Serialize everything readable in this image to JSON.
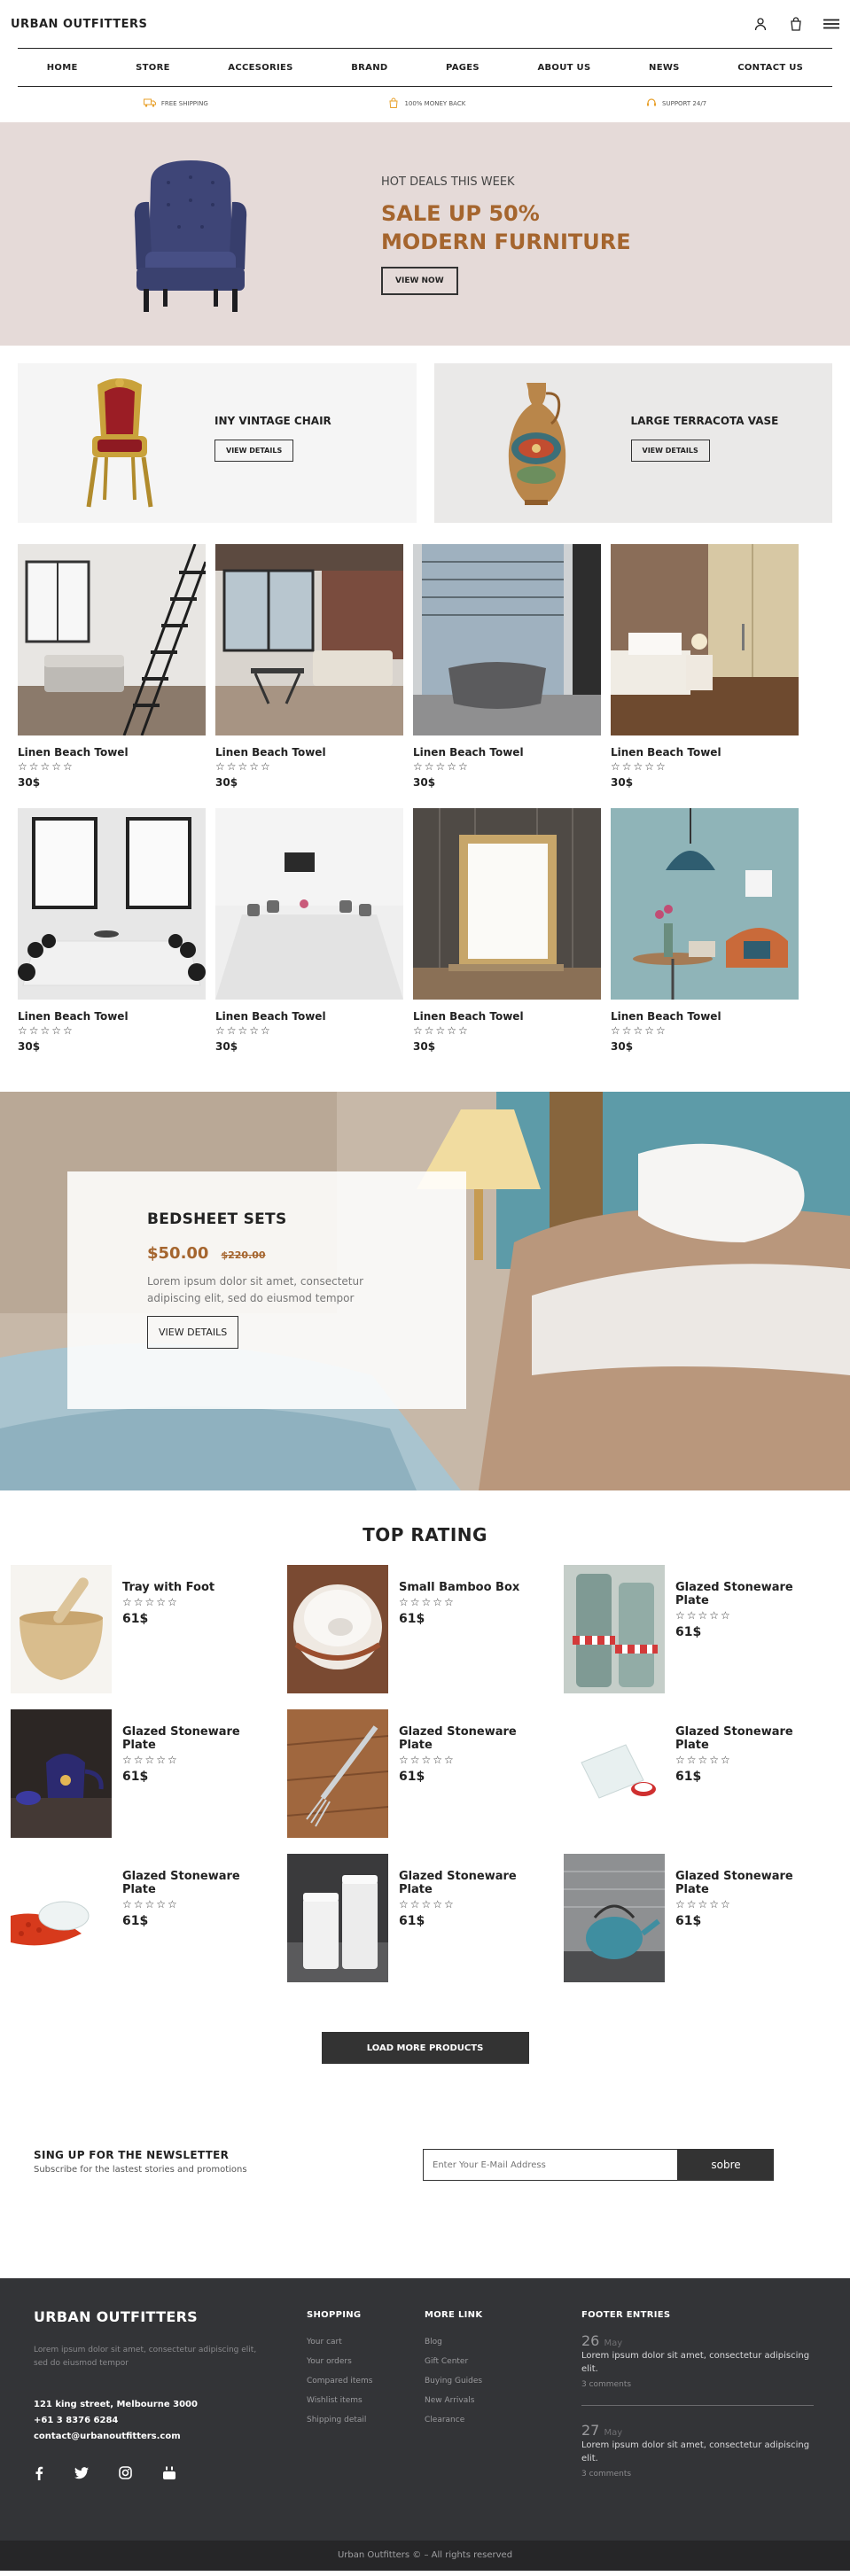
{
  "header": {
    "brand": "URBAN OUTFITTERS",
    "icons": [
      "user-icon",
      "bag-icon",
      "menu-icon"
    ]
  },
  "nav": [
    "HOME",
    "STORE",
    "ACCESORIES",
    "BRAND",
    "PAGES",
    "ABOUT US",
    "NEWS",
    "CONTACT US"
  ],
  "services": [
    {
      "icon": "truck-icon",
      "label": "FREE SHIPPING"
    },
    {
      "icon": "bag-money-icon",
      "label": "100% MONEY BACK"
    },
    {
      "icon": "support-icon",
      "label": "SUPPORT 24/7"
    }
  ],
  "hero": {
    "kicker": "HOT DEALS THIS WEEK",
    "title_line1": "SALE UP 50%",
    "title_line2": "MODERN FURNITURE",
    "button": "VIEW NOW"
  },
  "promos": [
    {
      "title": "INY VINTAGE CHAIR",
      "button": "VIEW DETAILS"
    },
    {
      "title": "LARGE TERRACOTA VASE",
      "button": "VIEW DETAILS"
    }
  ],
  "products": [
    {
      "name": "Linen Beach Towel",
      "stars": "☆☆☆☆☆",
      "price": "30$"
    },
    {
      "name": "Linen Beach Towel",
      "stars": "☆☆☆☆☆",
      "price": "30$"
    },
    {
      "name": "Linen Beach Towel",
      "stars": "☆☆☆☆☆",
      "price": "30$"
    },
    {
      "name": "Linen Beach Towel",
      "stars": "☆☆☆☆☆",
      "price": "30$"
    },
    {
      "name": "Linen Beach Towel",
      "stars": "☆☆☆☆☆",
      "price": "30$"
    },
    {
      "name": "Linen Beach Towel",
      "stars": "☆☆☆☆☆",
      "price": "30$"
    },
    {
      "name": "Linen Beach Towel",
      "stars": "☆☆☆☆☆",
      "price": "30$"
    },
    {
      "name": "Linen Beach Towel",
      "stars": "☆☆☆☆☆",
      "price": "30$"
    }
  ],
  "bedsheet": {
    "title": "BEDSHEET SETS",
    "price": "$50.00",
    "old_price": "$220.00",
    "description": "Lorem ipsum dolor sit amet, consectetur adipiscing elit, sed do eiusmod tempor",
    "button": "VIEW DETAILS"
  },
  "top_rating": {
    "title": "TOP RATING",
    "items": [
      {
        "name": "Tray with Foot",
        "stars": "☆☆☆☆☆",
        "price": "61$"
      },
      {
        "name": "Small Bamboo Box",
        "stars": "☆☆☆☆☆",
        "price": "61$"
      },
      {
        "name": "Glazed Stoneware Plate",
        "stars": "☆☆☆☆☆",
        "price": "61$"
      },
      {
        "name": "Glazed Stoneware Plate",
        "stars": "☆☆☆☆☆",
        "price": "61$"
      },
      {
        "name": "Glazed Stoneware Plate",
        "stars": "☆☆☆☆☆",
        "price": "61$"
      },
      {
        "name": "Glazed Stoneware Plate",
        "stars": "☆☆☆☆☆",
        "price": "61$"
      },
      {
        "name": "Glazed Stoneware Plate",
        "stars": "☆☆☆☆☆",
        "price": "61$"
      },
      {
        "name": "Glazed Stoneware Plate",
        "stars": "☆☆☆☆☆",
        "price": "61$"
      },
      {
        "name": "Glazed Stoneware Plate",
        "stars": "☆☆☆☆☆",
        "price": "61$"
      }
    ]
  },
  "load_more": "LOAD MORE PRODUCTS",
  "newsletter": {
    "title": "SING UP FOR THE NEWSLETTER",
    "subtitle": "Subscribe for the lastest stories and promotions",
    "placeholder": "Enter Your E-Mail Address",
    "button": "sobre"
  },
  "footer": {
    "brand": "URBAN OUTFITTERS",
    "description": "Lorem ipsum dolor sit amet, consectetur adipiscing elit, sed do eiusmod tempor",
    "address": "121 king street, Melbourne 3000",
    "phone": "+61 3 8376 6284",
    "email": "contact@urbanoutfitters.com",
    "social": [
      "facebook-icon",
      "twitter-icon",
      "instagram-icon",
      "youtube-icon"
    ],
    "shopping": {
      "title": "SHOPPING",
      "links": [
        "Your cart",
        "Your orders",
        "Compared items",
        "Wishlist items",
        "Shipping detail"
      ]
    },
    "more": {
      "title": "MORE LINK",
      "links": [
        "Blog",
        "Gift Center",
        "Buying Guides",
        "New Arrivals",
        "Clearance"
      ]
    },
    "entries": {
      "title": "FOOTER ENTRIES",
      "items": [
        {
          "day": "26",
          "month": "May",
          "text": "Lorem ipsum dolor sit amet, consectetur adipiscing elit.",
          "comments": "3 comments"
        },
        {
          "day": "27",
          "month": "May",
          "text": "Lorem ipsum dolor sit amet, consectetur adipiscing elit.",
          "comments": "3 comments"
        }
      ]
    },
    "copyright": "Urban Outfitters © – All rights reserved"
  },
  "colors": {
    "accent": "#a5652e",
    "hero_bg": "#e5dad8",
    "dark": "#333333",
    "service_icon": "#e8a02a"
  }
}
